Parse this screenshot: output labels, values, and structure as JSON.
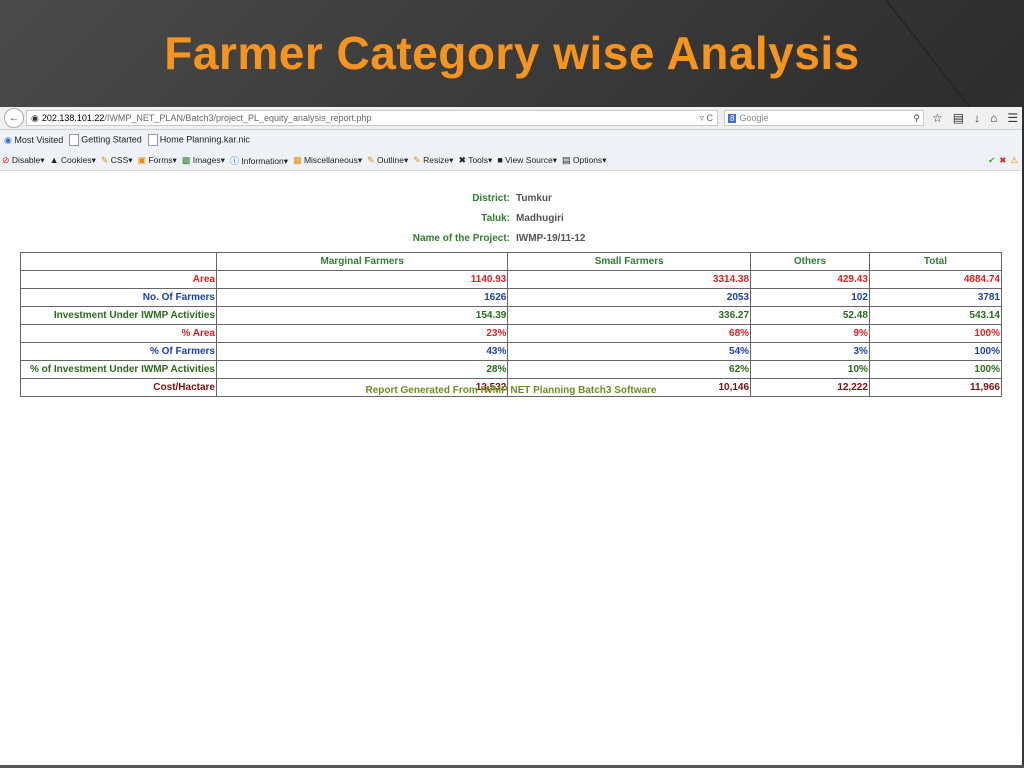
{
  "slide": {
    "title": "Farmer Category wise Analysis"
  },
  "browser": {
    "url_host": "202.138.101.22",
    "url_path": "/IWMP_NET_PLAN/Batch3/project_PL_equity_analysis_report.php",
    "search_placeholder": "Google",
    "bookmarks": [
      "Most Visited",
      "Getting Started",
      "Home  Planning.kar.nic"
    ],
    "devtools": [
      "Disable",
      "Cookies",
      "CSS",
      "Forms",
      "Images",
      "Information",
      "Miscellaneous",
      "Outline",
      "Resize",
      "Tools",
      "View Source",
      "Options"
    ]
  },
  "report": {
    "district_label": "District:",
    "district_value": "Tumkur",
    "taluk_label": "Taluk:",
    "taluk_value": "Madhugiri",
    "project_label": "Name of the Project:",
    "project_value": "IWMP-19/11-12",
    "columns": [
      "Marginal Farmers",
      "Small Farmers",
      "Others",
      "Total"
    ],
    "rows": [
      {
        "label": "Area",
        "values": [
          "1140.93",
          "3314.38",
          "429.43",
          "4884.74"
        ],
        "color": "#e02020"
      },
      {
        "label": "No. Of Farmers",
        "values": [
          "1626",
          "2053",
          "102",
          "3781"
        ],
        "color": "#1a3fb5"
      },
      {
        "label": "Investment Under IWMP Activities",
        "values": [
          "154.39",
          "336.27",
          "52.48",
          "543.14"
        ],
        "color": "#2a6b1c"
      },
      {
        "label": "% Area",
        "values": [
          "23%",
          "68%",
          "9%",
          "100%"
        ],
        "color": "#e02020"
      },
      {
        "label": "% Of Farmers",
        "values": [
          "43%",
          "54%",
          "3%",
          "100%"
        ],
        "color": "#1a3fb5"
      },
      {
        "label": "% of Investment Under IWMP Activities",
        "values": [
          "28%",
          "62%",
          "10%",
          "100%"
        ],
        "color": "#2a6b1c"
      },
      {
        "label": "Cost/Hactare",
        "values": [
          "13,532",
          "10,146",
          "12,222",
          "11,966"
        ],
        "color": "#7a1010"
      }
    ],
    "footer": "Report Generated From IWMP NET Planning Batch3 Software"
  }
}
